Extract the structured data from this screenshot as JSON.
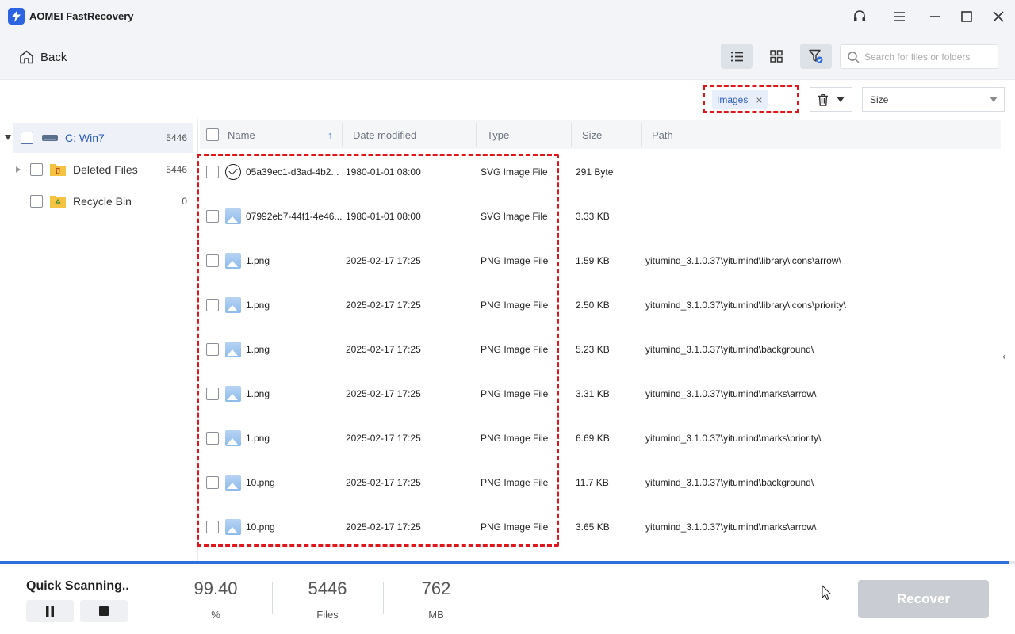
{
  "app": {
    "title": "AOMEI FastRecovery"
  },
  "toolbar": {
    "back_label": "Back",
    "search_placeholder": "Search for files or folders"
  },
  "filter": {
    "tag_label": "Images",
    "tag_close": "×",
    "sort_select": "Size"
  },
  "tree": {
    "items": [
      {
        "label": "C: Win7",
        "count": "5446"
      },
      {
        "label": "Deleted Files",
        "count": "5446"
      },
      {
        "label": "Recycle Bin",
        "count": "0"
      }
    ]
  },
  "table": {
    "columns": {
      "name": "Name",
      "date": "Date modified",
      "type": "Type",
      "size": "Size",
      "path": "Path"
    },
    "rows": [
      {
        "icon": "check-circle-icon",
        "name": "05a39ec1-d3ad-4b2...",
        "date": "1980-01-01 08:00",
        "type": "SVG Image File",
        "size": "291 Byte",
        "path": ""
      },
      {
        "icon": "image-file-icon",
        "name": "07992eb7-44f1-4e46...",
        "date": "1980-01-01 08:00",
        "type": "SVG Image File",
        "size": "3.33 KB",
        "path": ""
      },
      {
        "icon": "image-file-icon",
        "name": "1.png",
        "date": "2025-02-17 17:25",
        "type": "PNG Image File",
        "size": "1.59 KB",
        "path": "yitumind_3.1.0.37\\yitumind\\library\\icons\\arrow\\"
      },
      {
        "icon": "image-file-icon",
        "name": "1.png",
        "date": "2025-02-17 17:25",
        "type": "PNG Image File",
        "size": "2.50 KB",
        "path": "yitumind_3.1.0.37\\yitumind\\library\\icons\\priority\\"
      },
      {
        "icon": "image-file-icon",
        "name": "1.png",
        "date": "2025-02-17 17:25",
        "type": "PNG Image File",
        "size": "5.23 KB",
        "path": "yitumind_3.1.0.37\\yitumind\\background\\"
      },
      {
        "icon": "image-file-icon",
        "name": "1.png",
        "date": "2025-02-17 17:25",
        "type": "PNG Image File",
        "size": "3.31 KB",
        "path": "yitumind_3.1.0.37\\yitumind\\marks\\arrow\\"
      },
      {
        "icon": "image-file-icon",
        "name": "1.png",
        "date": "2025-02-17 17:25",
        "type": "PNG Image File",
        "size": "6.69 KB",
        "path": "yitumind_3.1.0.37\\yitumind\\marks\\priority\\"
      },
      {
        "icon": "image-file-icon",
        "name": "10.png",
        "date": "2025-02-17 17:25",
        "type": "PNG Image File",
        "size": "11.7 KB",
        "path": "yitumind_3.1.0.37\\yitumind\\background\\"
      },
      {
        "icon": "image-file-icon",
        "name": "10.png",
        "date": "2025-02-17 17:25",
        "type": "PNG Image File",
        "size": "3.65 KB",
        "path": "yitumind_3.1.0.37\\yitumind\\marks\\arrow\\"
      }
    ]
  },
  "scan": {
    "title": "Quick Scanning..",
    "progress_fraction": 0.994,
    "percent_value": "99.40",
    "percent_unit": "%",
    "files_value": "5446",
    "files_unit": "Files",
    "size_value": "762",
    "size_unit": "MB",
    "recover_label": "Recover"
  },
  "colors": {
    "accent": "#2e6fe0",
    "highlight": "#e0161b",
    "disabled_button": "#c9ccd2"
  }
}
